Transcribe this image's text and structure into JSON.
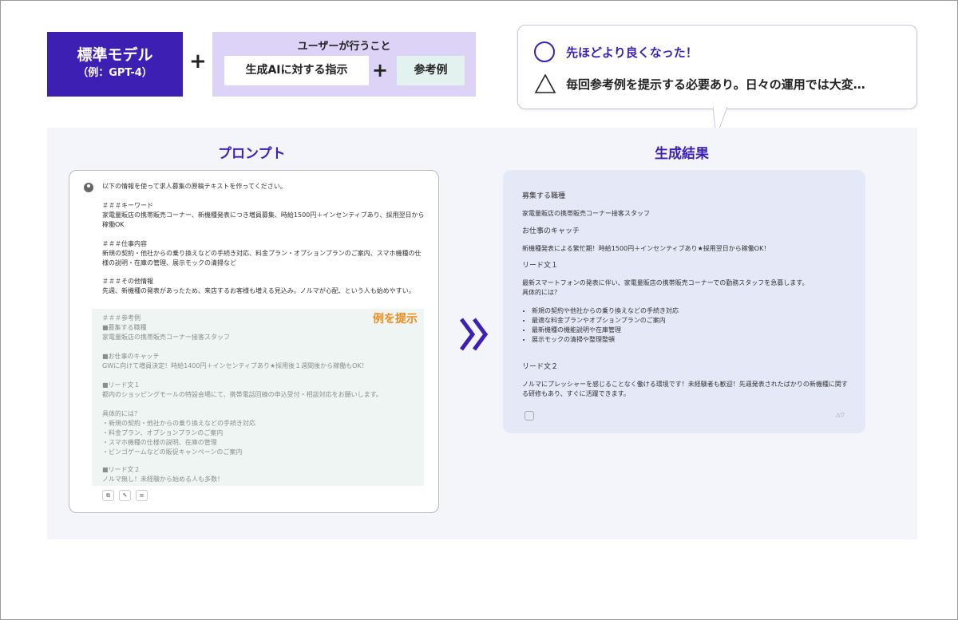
{
  "model_box": {
    "title": "標準モデル",
    "subtitle": "（例：GPT-4）"
  },
  "plus": "+",
  "user_box": {
    "title": "ユーザーが行うこと",
    "instruction": "生成AIに対する指示",
    "example": "参考例"
  },
  "bubble": {
    "good": "先ほどより良くなった！",
    "caution": "毎回参考例を提示する必要あり。日々の運用では大変…"
  },
  "prompt_section": {
    "title": "プロンプト",
    "intro": "以下の情報を使って求人募集の原稿テキストを作ってください。",
    "keyword_head": "＃＃＃キーワード",
    "keyword_body": "家電量販店の携帯販売コーナー、新機種発表につき増員募集、時給1500円＋インセンティブあり、採用翌日から稼働OK",
    "job_head": "＃＃＃仕事内容",
    "job_body": "新規の契約・他社からの乗り換えなどの手続き対応、料金プラン・オプションプランのご案内、スマホ機種の仕様の説明・在庫の管理、展示モックの清掃など",
    "other_head": "＃＃＃その他情報",
    "other_body": "先週、新機種の発表があったため、来店するお客様も増える見込み。ノルマが心配、という人も始めやすい。",
    "example_label": "例を提示",
    "example_lines": [
      "＃＃＃参考例",
      "■募集する職種",
      "家電量販店の携帯販売コーナー接客スタッフ",
      "",
      "■お仕事のキャッチ",
      "GWに向けて増員決定！時給1400円＋インセンティブあり★採用後１週間後から稼働もOK！",
      "",
      "■リード文１",
      "都内のショッピングモールの特設会場にて、携帯電話回線の申込受付・相談対応をお願いします。",
      "",
      "具体的には？",
      "・新規の契約・他社からの乗り換えなどの手続き対応",
      "・料金プラン、オプションプランのご案内",
      "・スマホ機種の仕様の説明、在庫の管理",
      "・ビンゴゲームなどの販促キャンペーンのご案内",
      "",
      "■リード文２",
      "ノルマ無し！未経験から始める人も多数！"
    ]
  },
  "result_section": {
    "title": "生成結果",
    "job_head": "募集する職種",
    "job_body": "家電量販店の携帯販売コーナー接客スタッフ",
    "catch_head": "お仕事のキャッチ",
    "catch_body": "新機種発表による繁忙期！時給1500円＋インセンティブあり★採用翌日から稼働OK！",
    "lead1_head": "リード文１",
    "lead1_body": "最新スマートフォンの発表に伴い、家電量販店の携帯販売コーナーでの勤務スタッフを急募します。",
    "lead1_sub": "具体的には？",
    "bullets": [
      "新規の契約や他社からの乗り換えなどの手続き対応",
      "最適な料金プランやオプションプランのご案内",
      "最新機種の機能説明や在庫管理",
      "展示モックの清掃や整理整頓"
    ],
    "lead2_head": "リード文２",
    "lead2_body": "ノルマにプレッシャーを感じることなく働ける環境です！未経験者も歓迎！先週発表されたばかりの新機種に関する研修もあり、すぐに活躍できます。"
  },
  "colors": {
    "accent": "#3d1fb3",
    "user_box": "#ddd3f6",
    "example_bg": "#eef5f3",
    "example_label": "#f08a1c",
    "result_bg": "#e5e8f7"
  }
}
